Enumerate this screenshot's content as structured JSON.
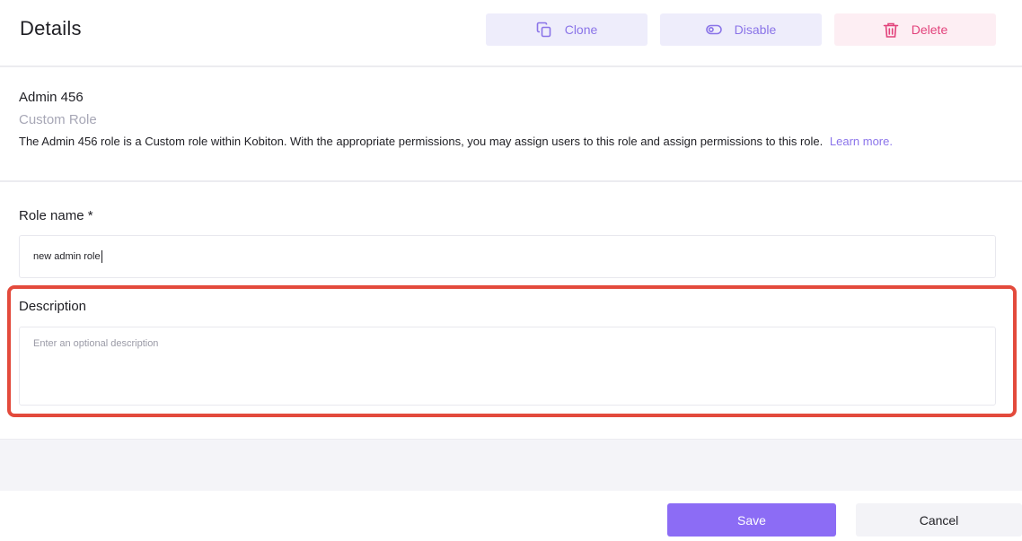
{
  "header": {
    "title": "Details",
    "clone_label": "Clone",
    "disable_label": "Disable",
    "delete_label": "Delete"
  },
  "info": {
    "role_title": "Admin 456",
    "role_type": "Custom Role",
    "description": "The Admin 456 role is a Custom role within Kobiton. With the appropriate permissions, you may assign users to this role and assign permissions to this role.",
    "learn_more": "Learn more."
  },
  "form": {
    "role_name_label": "Role name *",
    "role_name_value": "new admin role",
    "description_label": "Description",
    "description_placeholder": "Enter an optional description"
  },
  "footer": {
    "save_label": "Save",
    "cancel_label": "Cancel"
  },
  "colors": {
    "accent": "#8c6cf5",
    "danger": "#e2427b",
    "highlight": "#e34a3c"
  },
  "icons": [
    "clone-icon",
    "toggle-icon",
    "trash-icon"
  ]
}
